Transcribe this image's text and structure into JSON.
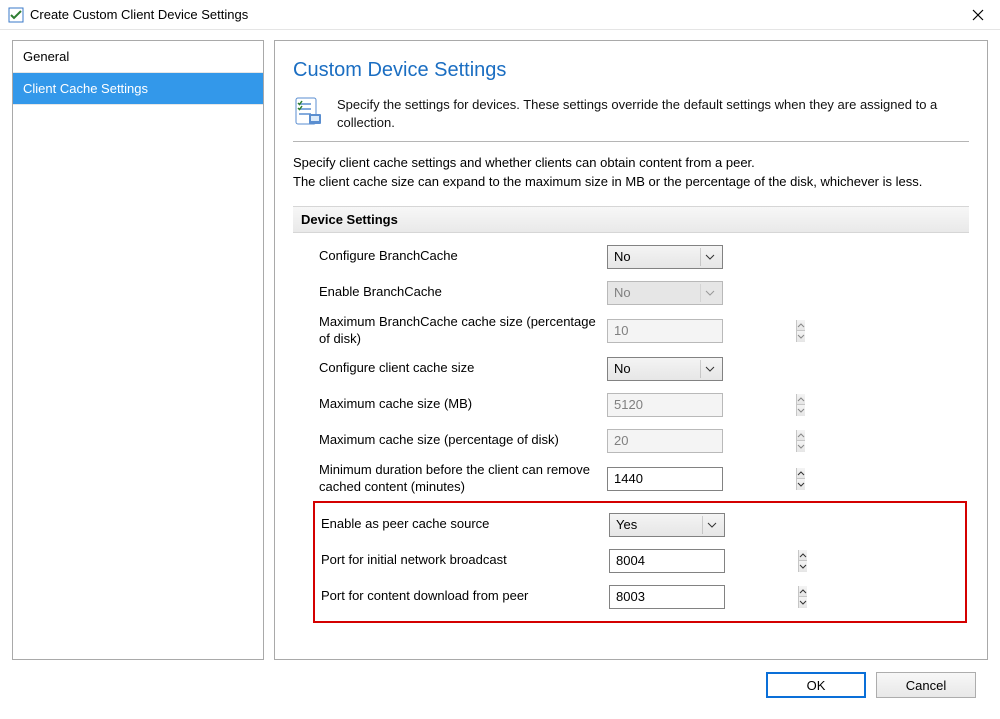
{
  "window": {
    "title": "Create Custom Client Device Settings"
  },
  "nav": {
    "items": [
      {
        "label": "General"
      },
      {
        "label": "Client Cache Settings"
      }
    ]
  },
  "content": {
    "title": "Custom Device Settings",
    "header_text": "Specify the settings for devices. These settings override the default settings when they are assigned to a collection.",
    "intro_line1": "Specify client cache settings and whether clients can obtain content from a peer.",
    "intro_line2": "The client cache size can expand to the maximum size in MB or the percentage of the disk, whichever is less.",
    "section_label": "Device Settings",
    "settings": {
      "configure_branchcache": {
        "label": "Configure BranchCache",
        "value": "No"
      },
      "enable_branchcache": {
        "label": "Enable BranchCache",
        "value": "No"
      },
      "max_branchcache_pct": {
        "label": "Maximum BranchCache cache size (percentage of disk)",
        "value": "10"
      },
      "configure_client_cache": {
        "label": "Configure client cache size",
        "value": "No"
      },
      "max_cache_mb": {
        "label": "Maximum cache size (MB)",
        "value": "5120"
      },
      "max_cache_pct": {
        "label": "Maximum cache size (percentage of disk)",
        "value": "20"
      },
      "min_duration": {
        "label": "Minimum duration before the client can remove cached content (minutes)",
        "value": "1440"
      },
      "enable_peer_cache": {
        "label": "Enable as peer cache source",
        "value": "Yes"
      },
      "port_broadcast": {
        "label": "Port for initial network broadcast",
        "value": "8004"
      },
      "port_download": {
        "label": "Port for content download from peer",
        "value": "8003"
      }
    }
  },
  "buttons": {
    "ok": "OK",
    "cancel": "Cancel"
  }
}
